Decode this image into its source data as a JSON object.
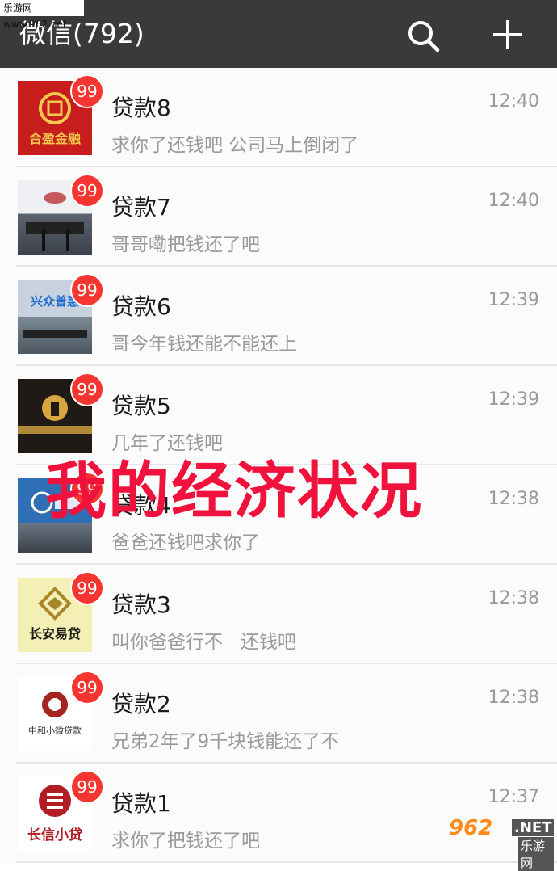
{
  "watermark_top": "乐游网 www.962.net",
  "header": {
    "title": "微信(792)"
  },
  "chats": [
    {
      "name": "贷款8",
      "time": "12:40",
      "preview": "求你了还钱吧 公司马上倒闭了",
      "badge": "99",
      "avatar_text": "合盈金融",
      "avatar_color": "#c81d1d"
    },
    {
      "name": "贷款7",
      "time": "12:40",
      "preview": "哥哥嘞把钱还了吧",
      "badge": "99",
      "avatar_text": "",
      "avatar_color": "#8e9aa8"
    },
    {
      "name": "贷款6",
      "time": "12:39",
      "preview": "哥今年钱还能不能还上",
      "badge": "99",
      "avatar_text": "兴众普惠",
      "avatar_color": "#b7c4d2"
    },
    {
      "name": "贷款5",
      "time": "12:39",
      "preview": "几年了还钱吧",
      "badge": "99",
      "avatar_text": "",
      "avatar_color": "#1f1a16"
    },
    {
      "name": "贷款4",
      "time": "12:38",
      "preview": "爸爸还钱吧求你了",
      "badge": "99",
      "avatar_text": "",
      "avatar_color": "#2f6fb6"
    },
    {
      "name": "贷款3",
      "time": "12:38",
      "preview": "叫你爸爸行不   还钱吧",
      "badge": "99",
      "avatar_text": "长安易贷",
      "avatar_color": "#f4efb4"
    },
    {
      "name": "贷款2",
      "time": "12:38",
      "preview": "兄弟2年了9千块钱能还了不",
      "badge": "99",
      "avatar_text": "中和小微贷款",
      "avatar_color": "#ffffff"
    },
    {
      "name": "贷款1",
      "time": "12:37",
      "preview": "求你了把钱还了吧",
      "badge": "99",
      "avatar_text": "长信小贷",
      "avatar_color": "#ffffff"
    }
  ],
  "overlay_text": "我的经济状况",
  "watermark_bottom": {
    "num": "962",
    "net": ".NET",
    "sub": "乐游网"
  },
  "colors": {
    "header_bg": "#3a3a3a",
    "badge": "#f43530",
    "overlay": "#f0123c"
  }
}
